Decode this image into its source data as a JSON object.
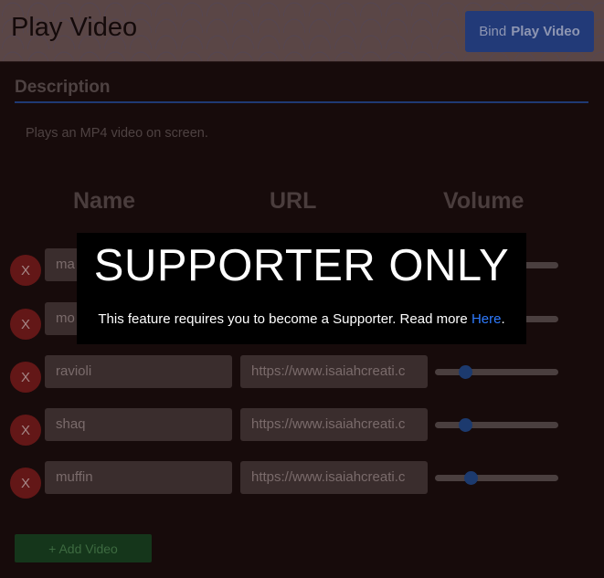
{
  "header": {
    "title": "Play Video",
    "bind_prefix": "Bind",
    "bind_action": "Play Video"
  },
  "description": {
    "heading": "Description",
    "text": "Plays an MP4 video on screen."
  },
  "columns": {
    "name": "Name",
    "url": "URL",
    "volume": "Volume"
  },
  "rows": [
    {
      "delete_label": "X",
      "name": "ma",
      "url": "",
      "volume": 0.2
    },
    {
      "delete_label": "X",
      "name": "mo",
      "url": "",
      "volume": 0.2
    },
    {
      "delete_label": "X",
      "name": "ravioli",
      "url": "https://www.isaiahcreati.c",
      "volume": 0.2
    },
    {
      "delete_label": "X",
      "name": "shaq",
      "url": "https://www.isaiahcreati.c",
      "volume": 0.2
    },
    {
      "delete_label": "X",
      "name": "muffin",
      "url": "https://www.isaiahcreati.c",
      "volume": 0.25
    }
  ],
  "add_button": "+ Add Video",
  "overlay": {
    "title": "SUPPORTER ONLY",
    "text": "This feature requires you to become a Supporter. Read more ",
    "link": "Here",
    "suffix": "."
  },
  "colors": {
    "accent": "#223a78",
    "overlay_link": "#2f7bff",
    "delete": "#631717",
    "add": "#15361b"
  }
}
